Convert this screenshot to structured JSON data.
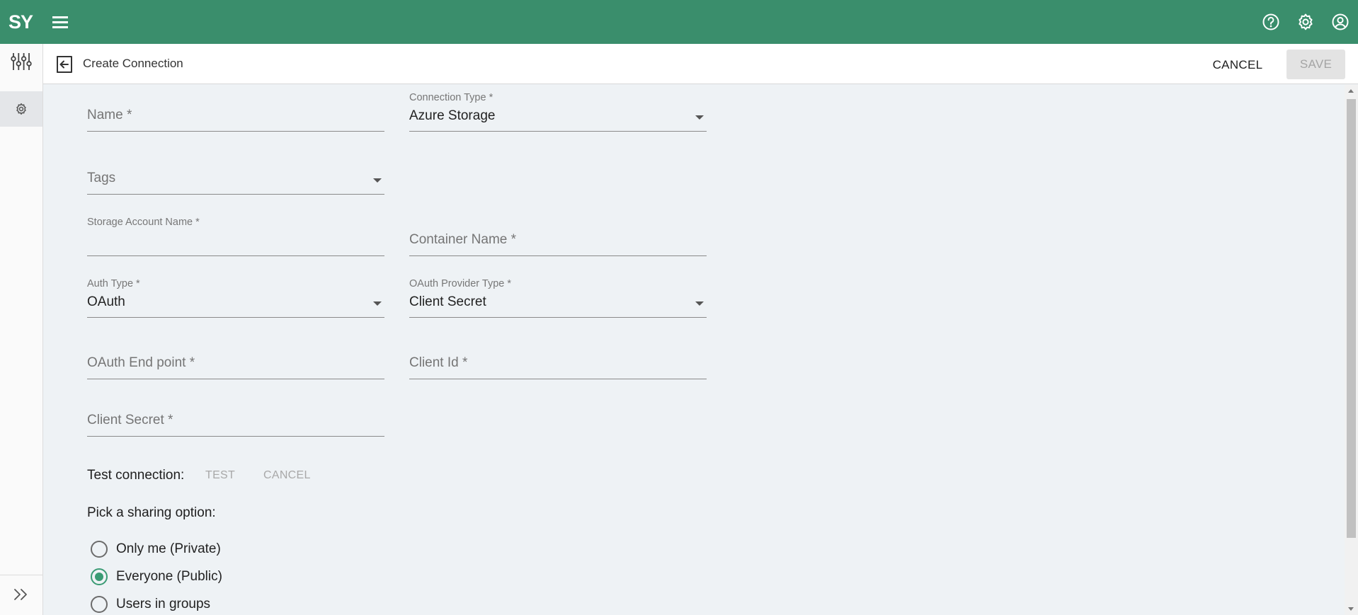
{
  "app": {
    "logo": "SY"
  },
  "colors": {
    "brand": "#3a8e6c",
    "accent": "#3a9b74",
    "background": "#eef2f5"
  },
  "topbar_icons": [
    "menu-icon",
    "help-icon",
    "gear-icon",
    "account-icon"
  ],
  "rail_icons": [
    "sliders-icon",
    "gear-icon",
    "expand-icon"
  ],
  "header": {
    "title": "Create Connection",
    "cancel_label": "CANCEL",
    "save_label": "SAVE"
  },
  "form": {
    "name": {
      "placeholder": "Name *"
    },
    "connection_type": {
      "label": "Connection Type *",
      "value": "Azure Storage"
    },
    "tags": {
      "placeholder": "Tags"
    },
    "storage_account_name": {
      "label": "Storage Account Name *",
      "value": ""
    },
    "container_name": {
      "placeholder": "Container Name *"
    },
    "auth_type": {
      "label": "Auth Type *",
      "value": "OAuth"
    },
    "oauth_provider_type": {
      "label": "OAuth Provider Type *",
      "value": "Client Secret"
    },
    "oauth_endpoint": {
      "placeholder": "OAuth End point *"
    },
    "client_id": {
      "placeholder": "Client Id *"
    },
    "client_secret": {
      "placeholder": "Client Secret *"
    }
  },
  "test": {
    "label": "Test connection:",
    "test_label": "TEST",
    "cancel_label": "CANCEL"
  },
  "sharing": {
    "label": "Pick a sharing option:",
    "options": [
      {
        "label": "Only me (Private)",
        "selected": false
      },
      {
        "label": "Everyone (Public)",
        "selected": true
      },
      {
        "label": "Users in groups",
        "selected": false
      }
    ]
  }
}
